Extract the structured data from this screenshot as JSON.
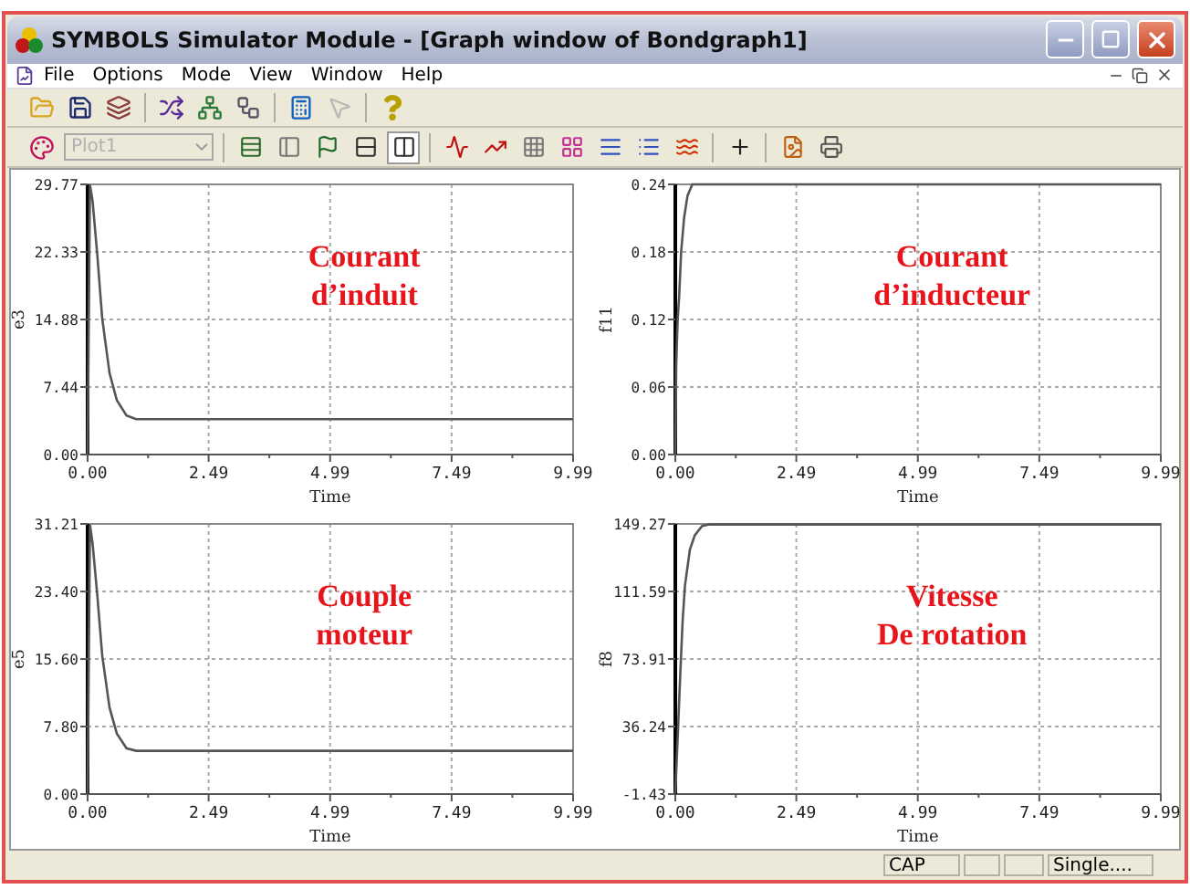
{
  "window": {
    "title": "SYMBOLS Simulator Module - [Graph window of Bondgraph1]"
  },
  "menu": [
    {
      "label": "File"
    },
    {
      "label": "Options"
    },
    {
      "label": "Mode"
    },
    {
      "label": "View"
    },
    {
      "label": "Window"
    },
    {
      "label": "Help"
    }
  ],
  "toolbar_1": [
    {
      "disabled": false
    },
    {
      "disabled": false
    },
    {
      "disabled": false
    },
    {
      "disabled": false
    },
    {
      "disabled": false
    },
    {
      "disabled": false
    },
    {
      "disabled": false
    },
    {
      "disabled": true
    },
    {
      "disabled": false
    }
  ],
  "toolbar_2": {
    "plot_select": {
      "value": "Plot1",
      "disabled": true
    },
    "buttons": [
      {
        "selected": false
      },
      {
        "selected": false
      },
      {
        "selected": false
      },
      {
        "selected": false
      },
      {
        "selected": true
      },
      {
        "selected": false
      },
      {
        "selected": false
      },
      {
        "selected": false
      },
      {
        "selected": false
      },
      {
        "selected": false
      },
      {
        "selected": false
      },
      {
        "selected": false
      },
      {
        "selected": false
      },
      {
        "selected": false
      },
      {
        "selected": false
      }
    ]
  },
  "graphs": [
    {
      "chart_data": {
        "type": "line",
        "xlabel": "Time",
        "ylabel": "e3",
        "grid": true,
        "x": [
          0,
          0.05,
          0.1,
          0.2,
          0.3,
          0.45,
          0.6,
          0.8,
          1,
          2,
          5,
          9.99
        ],
        "series": [
          {
            "color": "#555555",
            "values": [
              0,
              29.7,
              28,
              22,
              15,
              9,
              6,
              4.3,
              3.9,
              3.9,
              3.9,
              3.9
            ]
          }
        ],
        "xlim": [
          0,
          9.99
        ],
        "ylim": [
          0,
          29.77
        ],
        "xticks": [
          {
            "value": 0,
            "label": "0.00"
          },
          {
            "value": 2.49,
            "label": "2.49"
          },
          {
            "value": 4.99,
            "label": "4.99"
          },
          {
            "value": 7.49,
            "label": "7.49"
          },
          {
            "value": 9.99,
            "label": "9.99"
          }
        ],
        "yticks": [
          {
            "value": 0,
            "label": "0.00"
          },
          {
            "value": 7.44,
            "label": "7.44"
          },
          {
            "value": 14.88,
            "label": "14.88"
          },
          {
            "value": 22.33,
            "label": "22.33"
          },
          {
            "value": 29.77,
            "label": "29.77"
          }
        ],
        "annotations": [
          "Courant",
          "d’induit"
        ]
      }
    },
    {
      "chart_data": {
        "type": "line",
        "xlabel": "Time",
        "ylabel": "f11",
        "grid": true,
        "x": [
          0,
          0.02,
          0.05,
          0.08,
          0.12,
          0.18,
          0.25,
          0.35,
          0.45,
          1,
          5,
          9.99
        ],
        "series": [
          {
            "color": "#555555",
            "values": [
              0,
              0.08,
              0.12,
              0.14,
              0.18,
              0.21,
              0.23,
              0.24,
              0.24,
              0.24,
              0.24,
              0.24
            ]
          }
        ],
        "xlim": [
          0,
          9.99
        ],
        "ylim": [
          0,
          0.24
        ],
        "xticks": [
          {
            "value": 0,
            "label": "0.00"
          },
          {
            "value": 2.49,
            "label": "2.49"
          },
          {
            "value": 4.99,
            "label": "4.99"
          },
          {
            "value": 7.49,
            "label": "7.49"
          },
          {
            "value": 9.99,
            "label": "9.99"
          }
        ],
        "yticks": [
          {
            "value": 0,
            "label": "0.00"
          },
          {
            "value": 0.06,
            "label": "0.06"
          },
          {
            "value": 0.12,
            "label": "0.12"
          },
          {
            "value": 0.18,
            "label": "0.18"
          },
          {
            "value": 0.24,
            "label": "0.24"
          }
        ],
        "annotations": [
          "Courant",
          "d’inducteur"
        ]
      }
    },
    {
      "chart_data": {
        "type": "line",
        "xlabel": "Time",
        "ylabel": "e5",
        "grid": true,
        "x": [
          0,
          0.05,
          0.1,
          0.2,
          0.3,
          0.45,
          0.6,
          0.8,
          1,
          2,
          5,
          9.99
        ],
        "series": [
          {
            "color": "#555555",
            "values": [
              0,
              31.1,
              29,
              23,
              16,
              10,
              7,
              5.3,
              5,
              5,
              5,
              5
            ]
          }
        ],
        "xlim": [
          0,
          9.99
        ],
        "ylim": [
          0,
          31.21
        ],
        "xticks": [
          {
            "value": 0,
            "label": "0.00"
          },
          {
            "value": 2.49,
            "label": "2.49"
          },
          {
            "value": 4.99,
            "label": "4.99"
          },
          {
            "value": 7.49,
            "label": "7.49"
          },
          {
            "value": 9.99,
            "label": "9.99"
          }
        ],
        "yticks": [
          {
            "value": 0,
            "label": "0.00"
          },
          {
            "value": 7.8,
            "label": "7.80"
          },
          {
            "value": 15.6,
            "label": "15.60"
          },
          {
            "value": 23.4,
            "label": "23.40"
          },
          {
            "value": 31.21,
            "label": "31.21"
          }
        ],
        "annotations": [
          "Couple",
          "moteur"
        ]
      }
    },
    {
      "chart_data": {
        "type": "line",
        "xlabel": "Time",
        "ylabel": "f8",
        "grid": true,
        "x": [
          0,
          0.05,
          0.1,
          0.15,
          0.2,
          0.3,
          0.4,
          0.55,
          0.7,
          1,
          5,
          9.99
        ],
        "series": [
          {
            "color": "#555555",
            "values": [
              -1,
              30,
              65,
              95,
              115,
              135,
              143,
              148,
              149,
              149,
              149,
              149
            ]
          }
        ],
        "xlim": [
          0,
          9.99
        ],
        "ylim": [
          -1.43,
          149.27
        ],
        "xticks": [
          {
            "value": 0,
            "label": "0.00"
          },
          {
            "value": 2.49,
            "label": "2.49"
          },
          {
            "value": 4.99,
            "label": "4.99"
          },
          {
            "value": 7.49,
            "label": "7.49"
          },
          {
            "value": 9.99,
            "label": "9.99"
          }
        ],
        "yticks": [
          {
            "value": -1.43,
            "label": "-1.43"
          },
          {
            "value": 36.24,
            "label": "36.24"
          },
          {
            "value": 73.91,
            "label": "73.91"
          },
          {
            "value": 111.59,
            "label": "111.59"
          },
          {
            "value": 149.27,
            "label": "149.27"
          }
        ],
        "annotations": [
          "Vitesse",
          "De rotation"
        ]
      }
    }
  ],
  "status_bar": {
    "panes": [
      {
        "text": "CAP"
      },
      {
        "text": "Single...."
      }
    ]
  }
}
